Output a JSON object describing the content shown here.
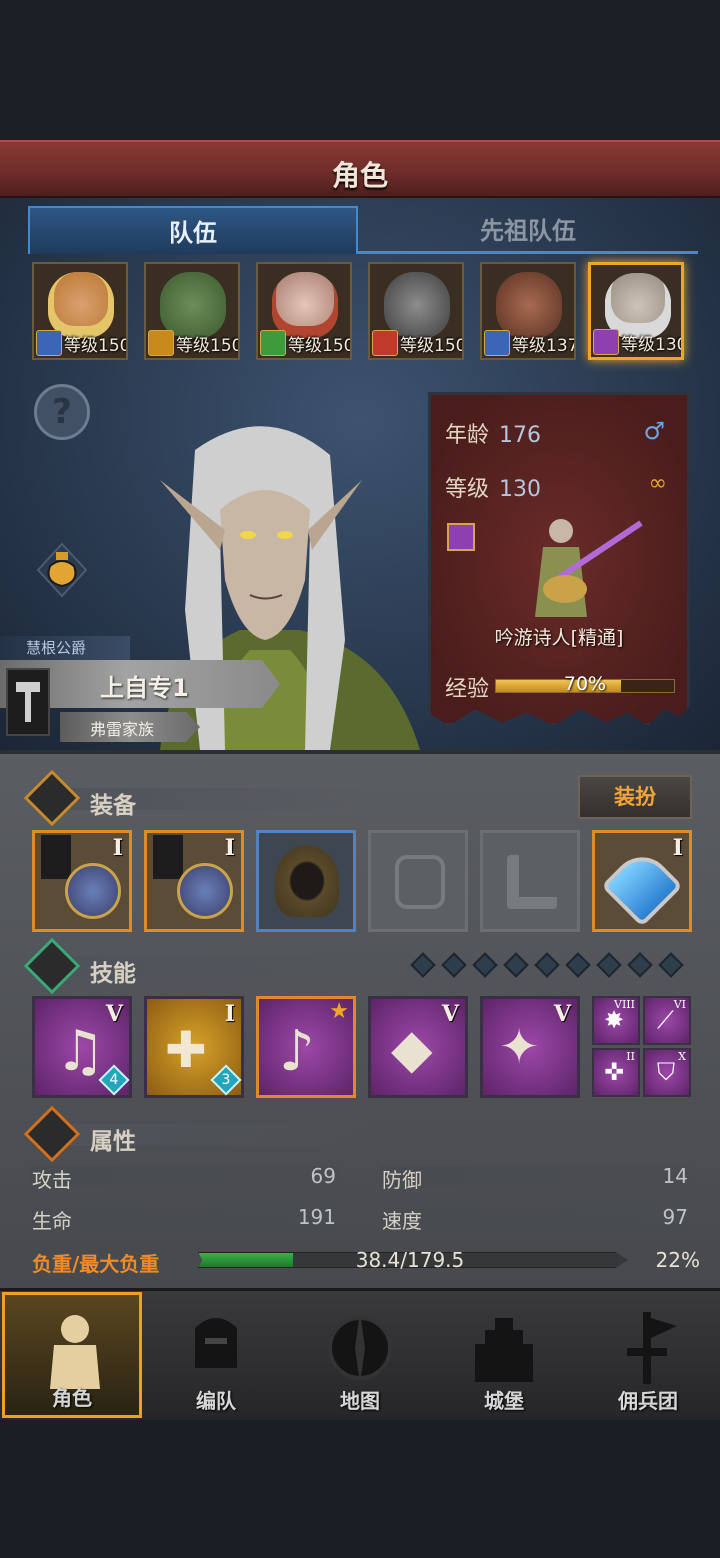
{
  "header": {
    "title": "角色"
  },
  "tabs": [
    {
      "label": "队伍",
      "active": true
    },
    {
      "label": "先祖队伍",
      "active": false
    }
  ],
  "heroes": [
    {
      "level_text": "等级150",
      "class_icon": "sword-icon",
      "selected": false
    },
    {
      "level_text": "等级150",
      "class_icon": "shield-icon",
      "selected": false
    },
    {
      "level_text": "等级150",
      "class_icon": "crossed-swords-icon",
      "selected": false
    },
    {
      "level_text": "等级150",
      "class_icon": "horse-icon",
      "selected": false
    },
    {
      "level_text": "等级137",
      "class_icon": "sword-icon",
      "selected": false
    },
    {
      "level_text": "等级130",
      "class_icon": "staff-icon",
      "selected": true
    }
  ],
  "character": {
    "title_tag": "慧根公爵",
    "name": "上自专1",
    "family": "弗雷家族",
    "age_label": "年龄",
    "age": "176",
    "level_label": "等级",
    "level": "130",
    "job": "吟游诗人[精通]",
    "exp_label": "经验",
    "exp_text": "70%",
    "exp_fraction": 0.7
  },
  "equipment": {
    "section_title": "装备",
    "dress_button": "装扮",
    "slots": [
      {
        "name": "lute-weapon",
        "tier": "I",
        "state": "gold"
      },
      {
        "name": "lute-weapon",
        "tier": "I",
        "state": "gold"
      },
      {
        "name": "hood",
        "tier": "",
        "state": "blue"
      },
      {
        "name": "armor-empty",
        "tier": "",
        "state": "empty"
      },
      {
        "name": "boots-empty",
        "tier": "",
        "state": "empty"
      },
      {
        "name": "heart-amulet",
        "tier": "I",
        "state": "gold"
      }
    ]
  },
  "skills": {
    "section_title": "技能",
    "gem_count": 9,
    "items": [
      {
        "name": "song-skill",
        "tier": "V",
        "count": "4",
        "style": "purple"
      },
      {
        "name": "heal-shield-skill",
        "tier": "I",
        "count": "3",
        "style": "yellow"
      },
      {
        "name": "crystal-song-skill",
        "tier": "",
        "count": "",
        "style": "purple",
        "selected": true
      },
      {
        "name": "crystal-hand-skill",
        "tier": "V",
        "count": "",
        "style": "purple"
      },
      {
        "name": "group-heal-skill",
        "tier": "V",
        "count": "",
        "style": "purple"
      }
    ],
    "mini": [
      {
        "name": "burst-skill",
        "tier": "VIII"
      },
      {
        "name": "spear-skill",
        "tier": "VI"
      },
      {
        "name": "target-skill",
        "tier": "II"
      },
      {
        "name": "guard-skill",
        "tier": "X"
      }
    ]
  },
  "attributes": {
    "section_title": "属性",
    "attack_label": "攻击",
    "attack": "69",
    "defense_label": "防御",
    "defense": "14",
    "hp_label": "生命",
    "hp": "191",
    "speed_label": "速度",
    "speed": "97",
    "load_label": "负重/最大负重",
    "load_text": "38.4/179.5",
    "load_pct": "22%",
    "load_fraction": 0.22
  },
  "nav": [
    {
      "label": "角色",
      "active": true
    },
    {
      "label": "编队",
      "active": false
    },
    {
      "label": "地图",
      "active": false
    },
    {
      "label": "城堡",
      "active": false
    },
    {
      "label": "佣兵团",
      "active": false
    }
  ],
  "colors": {
    "accent_gold": "#f0a623",
    "tab_blue": "#3f8ad1",
    "load_green": "#3dae4b",
    "title_red": "#6c2b28"
  }
}
